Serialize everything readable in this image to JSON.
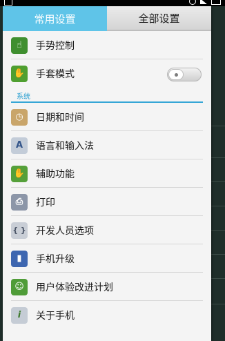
{
  "tabs": [
    {
      "label": "常用设置",
      "active": false
    },
    {
      "label": "全部设置",
      "active": true
    }
  ],
  "top_items": [
    {
      "label": "手势控制",
      "icon": "gesture-control-icon",
      "color": "#3f8f2f",
      "glyph": "☝"
    },
    {
      "label": "手套模式",
      "icon": "glove-mode-icon",
      "color": "#4f9f30",
      "glyph": "✋",
      "toggle": false
    }
  ],
  "section_title": "系统",
  "system_items": [
    {
      "label": "日期和时间",
      "icon": "clock-icon",
      "color": "#c9a56a",
      "glyph": "◷"
    },
    {
      "label": "语言和输入法",
      "icon": "keyboard-letter-icon",
      "color": "#c3ccd8",
      "glyph": "A"
    },
    {
      "label": "辅助功能",
      "icon": "hand-icon",
      "color": "#55a03a",
      "glyph": "✋"
    },
    {
      "label": "打印",
      "icon": "printer-icon",
      "color": "#8c96a8",
      "glyph": "⎙"
    },
    {
      "label": "开发人员选项",
      "icon": "braces-icon",
      "color": "#c9ced6",
      "glyph": "{ }"
    },
    {
      "label": "手机升级",
      "icon": "phone-upgrade-icon",
      "color": "#3d66b0",
      "glyph": "▮"
    },
    {
      "label": "用户体验改进计划",
      "icon": "user-experience-icon",
      "color": "#4f9c38",
      "glyph": "👤"
    },
    {
      "label": "关于手机",
      "icon": "info-icon",
      "color": "#c5ccd5",
      "glyph": "i"
    }
  ]
}
